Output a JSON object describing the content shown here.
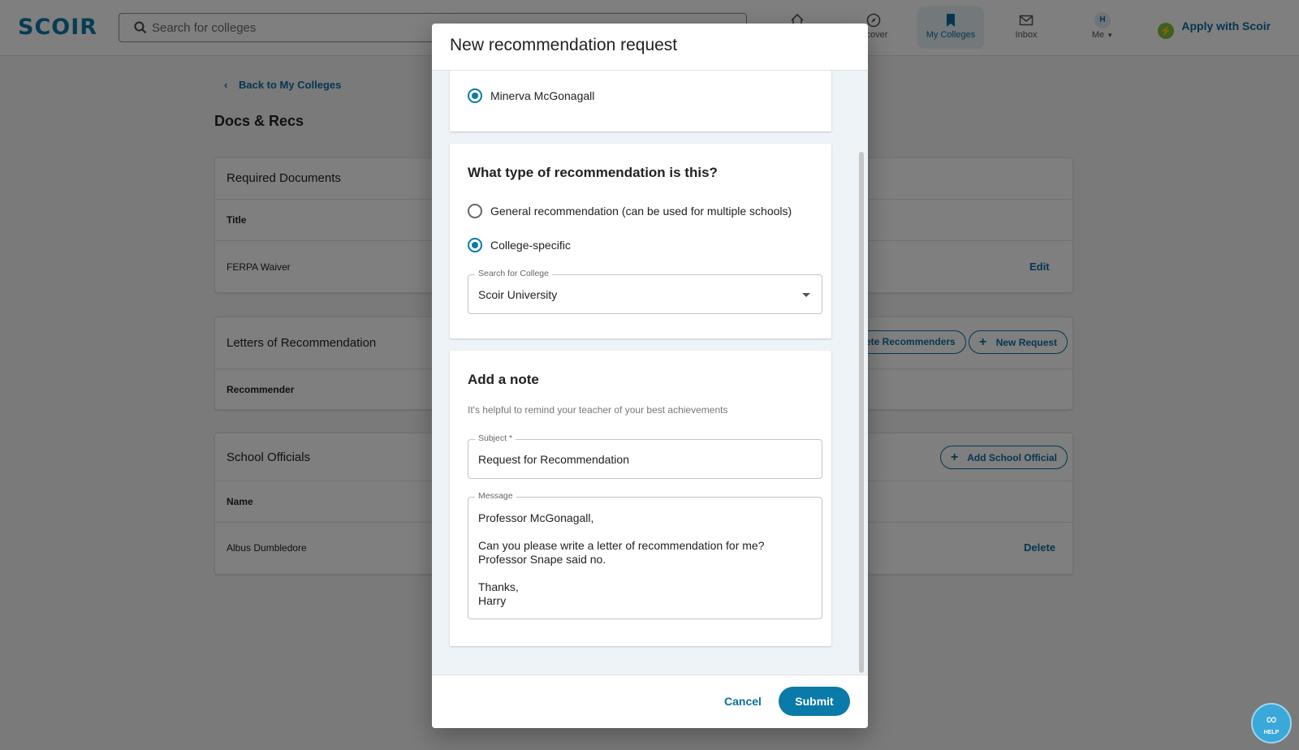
{
  "header": {
    "logo": "SCOIR",
    "search_placeholder": "Search for colleges",
    "nav": {
      "discover": "iscover",
      "my_colleges": "My Colleges",
      "inbox": "Inbox",
      "me": "Me",
      "avatar_initial": "H"
    },
    "apply": "Apply with Scoir"
  },
  "page": {
    "back": "Back to My Colleges",
    "title": "Docs & Recs",
    "required_docs": {
      "title": "Required Documents",
      "col_title": "Title",
      "rows": [
        {
          "name": "FERPA Waiver",
          "action": "Edit"
        }
      ]
    },
    "letters": {
      "title": "Letters of Recommendation",
      "col_recommender": "Recommender",
      "delete_recommenders": "ete Recommenders",
      "new_request": "New Request"
    },
    "officials": {
      "title": "School Officials",
      "col_name": "Name",
      "add": "Add School Official",
      "rows": [
        {
          "name": "Albus Dumbledore",
          "action": "Delete"
        }
      ]
    }
  },
  "dialog": {
    "title": "New recommendation request",
    "recommender": {
      "selected_name": "Minerva McGonagall"
    },
    "type_section": {
      "heading": "What type of recommendation is this?",
      "option_general": "General recommendation (can be used for multiple schools)",
      "option_specific": "College-specific",
      "selected": "College-specific",
      "college_label": "Search for College",
      "college_value": "Scoir University"
    },
    "note_section": {
      "heading": "Add a note",
      "hint": "It's helpful to remind your teacher of your best achievements",
      "subject_label": "Subject *",
      "subject_value": "Request for Recommendation",
      "message_label": "Message",
      "message_lines": [
        "Professor McGonagall,",
        "Can you please write a letter of recommendation for me?",
        "Professor Snape said no.",
        "Thanks,",
        "Harry"
      ]
    },
    "cancel": "Cancel",
    "submit": "Submit"
  },
  "help": {
    "label": "HELP"
  },
  "colors": {
    "accent": "#0a7aa8",
    "link": "#0a6fa0",
    "apply_green": "#7cbe3a",
    "overlay": "rgba(0,0,0,0.5)"
  }
}
